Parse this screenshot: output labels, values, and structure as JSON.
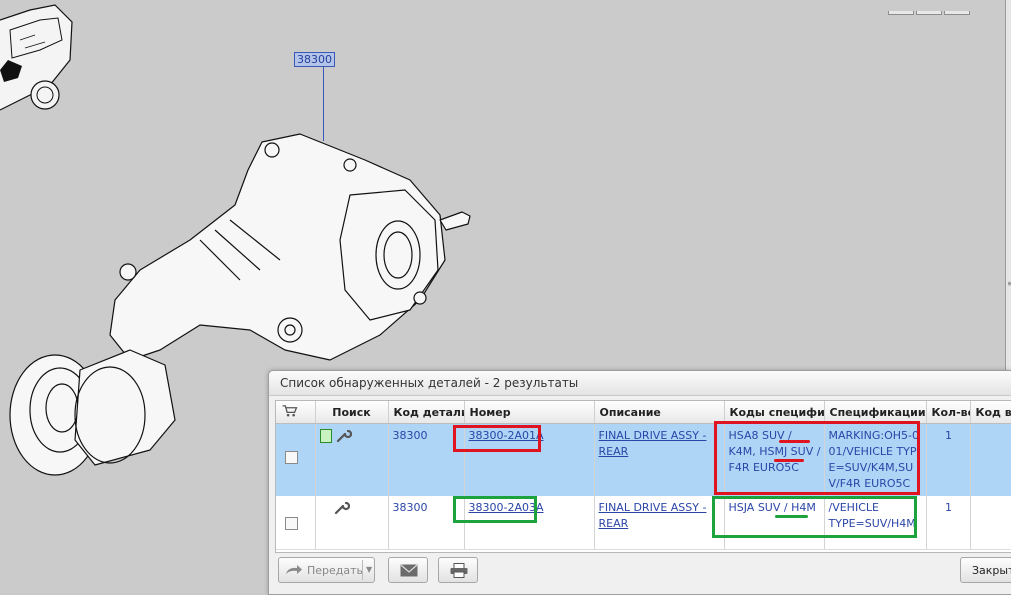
{
  "illustration": {
    "callout_label": "38300"
  },
  "dialog": {
    "title": "Список обнаруженных деталей - 2 результаты",
    "columns": [
      "",
      "Поиск",
      "Код детали",
      "Номер",
      "Описание",
      "Коды специфик",
      "Спецификации",
      "Кол-во",
      "Код вз"
    ],
    "rows": [
      {
        "code": "38300",
        "number": "38300-2A01A",
        "description": "FINAL DRIVE ASSY - REAR",
        "spec_codes": "HSA8 SUV / K4M, HSMJ SUV / F4R EURO5C",
        "specs": "MARKING:OH5-001/VEHICLE TYPE=SUV/K4M,SUV/F4R EURO5C",
        "qty": "1",
        "highlight": "red",
        "selected": true
      },
      {
        "code": "38300",
        "number": "38300-2A03A",
        "description": "FINAL DRIVE ASSY - REAR",
        "spec_codes": "HSJA SUV / H4M",
        "specs": "/VEHICLE TYPE=SUV/H4M",
        "qty": "1",
        "highlight": "green",
        "selected": false
      }
    ],
    "buttons": {
      "send_label": "Передать",
      "close_label": "Закрыт"
    }
  },
  "icons": [
    "cart-icon",
    "document-icon",
    "wrench-icon",
    "forward-arrow-icon",
    "mail-icon",
    "printer-icon"
  ],
  "colors": {
    "selected_row": "#aed4f6",
    "annotation_red": "#e0141e",
    "annotation_green": "#1ca33d",
    "link": "#2b46a8"
  }
}
